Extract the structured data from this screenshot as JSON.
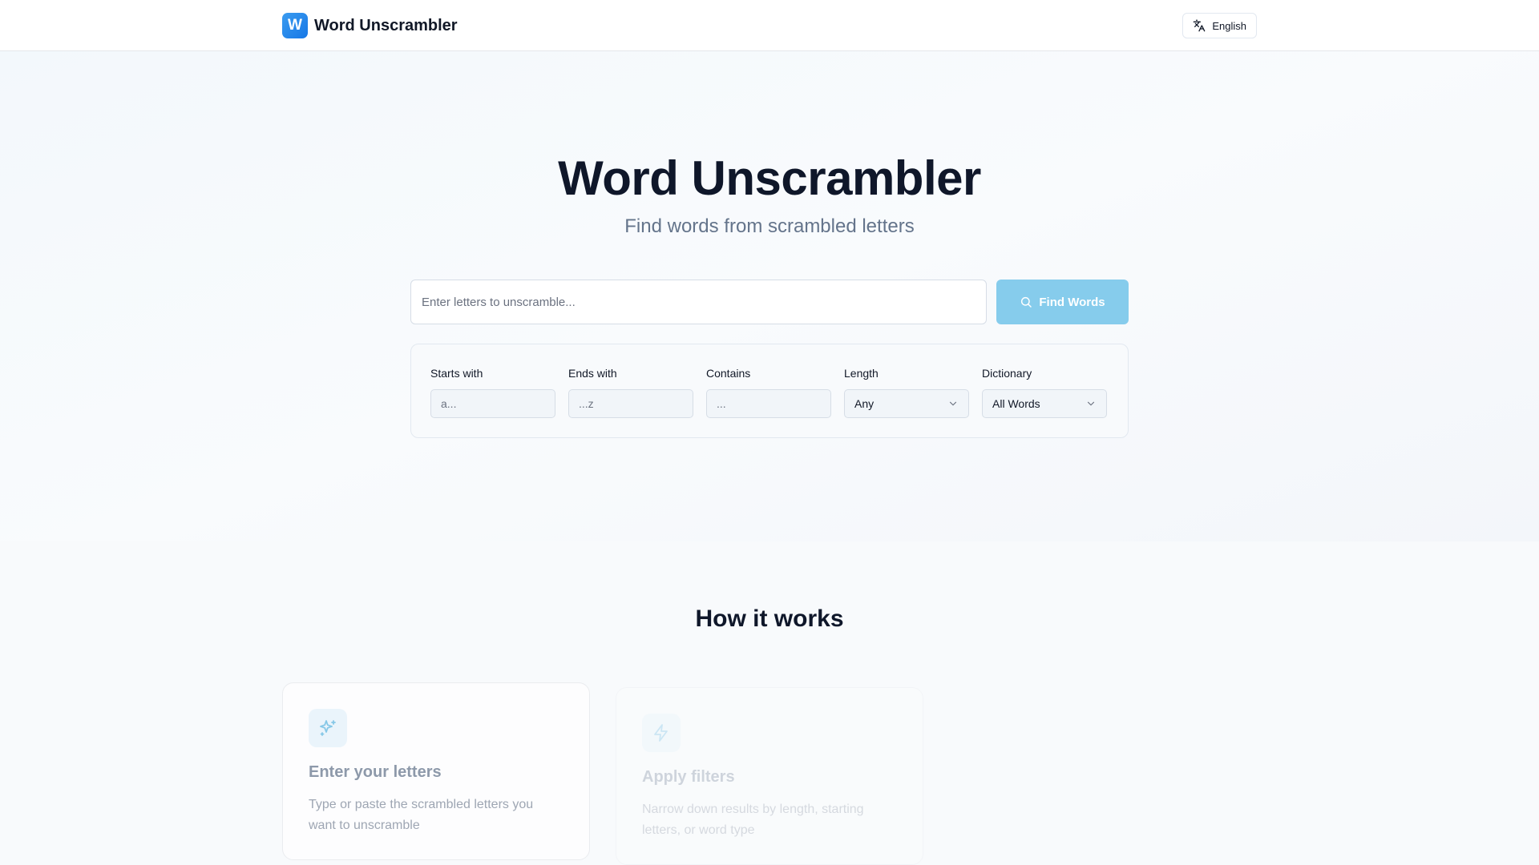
{
  "header": {
    "logo_letter": "W",
    "brand_name": "Word Unscrambler",
    "language_label": "English"
  },
  "hero": {
    "title": "Word Unscrambler",
    "subtitle": "Find words from scrambled letters",
    "search_placeholder": "Enter letters to unscramble...",
    "search_value": "",
    "find_button_label": "Find Words"
  },
  "filters": {
    "starts_with": {
      "label": "Starts with",
      "placeholder": "a..."
    },
    "ends_with": {
      "label": "Ends with",
      "placeholder": "...z"
    },
    "contains": {
      "label": "Contains",
      "placeholder": "..."
    },
    "length": {
      "label": "Length",
      "selected": "Any"
    },
    "dictionary": {
      "label": "Dictionary",
      "selected": "All Words"
    }
  },
  "how_it_works": {
    "title": "How it works",
    "steps": [
      {
        "icon": "sparkles-icon",
        "title": "Enter your letters",
        "description": "Type or paste the scrambled letters you want to unscramble"
      },
      {
        "icon": "lightning-icon",
        "title": "Apply filters",
        "description": "Narrow down results by length, starting letters, or word type"
      }
    ]
  },
  "colors": {
    "brand_blue": "#1677e6",
    "find_button": "#86ccec",
    "icon_accent": "#5bb5e0",
    "text_dark": "#0f172a",
    "text_muted": "#64748b"
  }
}
